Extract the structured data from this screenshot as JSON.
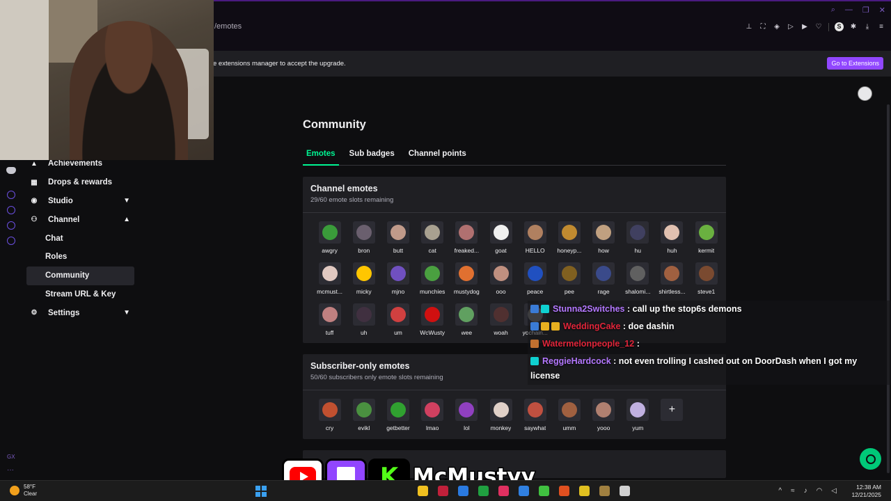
{
  "browser": {
    "url": "/emotes",
    "notice": "e extensions manager to accept the upgrade.",
    "notice_button": "Go to Extensions"
  },
  "sidebar": {
    "items": [
      {
        "label": "Achievements",
        "icon": "trophy-icon"
      },
      {
        "label": "Drops & rewards",
        "icon": "gift-icon"
      },
      {
        "label": "Studio",
        "icon": "studio-icon",
        "chevron": "down"
      },
      {
        "label": "Channel",
        "icon": "people-icon",
        "chevron": "up"
      },
      {
        "label": "Chat"
      },
      {
        "label": "Roles"
      },
      {
        "label": "Community",
        "active": true
      },
      {
        "label": "Stream URL & Key"
      },
      {
        "label": "Settings",
        "icon": "gear-icon",
        "chevron": "down"
      }
    ],
    "gx_label": "GX",
    "more_label": "···"
  },
  "page": {
    "title": "Community",
    "tabs": [
      "Emotes",
      "Sub badges",
      "Channel points"
    ],
    "active_tab": 0
  },
  "channel_emotes": {
    "title": "Channel emotes",
    "subtitle": "29/60 emote slots remaining",
    "emotes": [
      {
        "name": "awgry",
        "color": "#3a9b3a"
      },
      {
        "name": "bron",
        "color": "#6a5f6e"
      },
      {
        "name": "butt",
        "color": "#c09a8a"
      },
      {
        "name": "cat",
        "color": "#a8a090"
      },
      {
        "name": "freaked...",
        "color": "#b07070"
      },
      {
        "name": "goat",
        "color": "#f0f0f0"
      },
      {
        "name": "HELLO",
        "color": "#b08060"
      },
      {
        "name": "honeyp...",
        "color": "#c08a30"
      },
      {
        "name": "how",
        "color": "#c0a080"
      },
      {
        "name": "hu",
        "color": "#404060"
      },
      {
        "name": "huh",
        "color": "#e0c0b0"
      },
      {
        "name": "kermit",
        "color": "#6ab040"
      },
      {
        "name": "mcmust...",
        "color": "#e0c8c0"
      },
      {
        "name": "micky",
        "color": "#ffc600"
      },
      {
        "name": "mjno",
        "color": "#7050c0"
      },
      {
        "name": "munchies",
        "color": "#4aa040"
      },
      {
        "name": "mustydog",
        "color": "#e07030"
      },
      {
        "name": "ooo",
        "color": "#c09080"
      },
      {
        "name": "peace",
        "color": "#2050c0"
      },
      {
        "name": "pee",
        "color": "#806020"
      },
      {
        "name": "rage",
        "color": "#3a4a8a"
      },
      {
        "name": "shalomi...",
        "color": "#606060"
      },
      {
        "name": "shirtless...",
        "color": "#a06040"
      },
      {
        "name": "steve1",
        "color": "#7a4a30"
      },
      {
        "name": "tuff",
        "color": "#c08080"
      },
      {
        "name": "uh",
        "color": "#403040"
      },
      {
        "name": "um",
        "color": "#d04040"
      },
      {
        "name": "WcWusty",
        "color": "#d01010"
      },
      {
        "name": "wee",
        "color": "#60a060"
      },
      {
        "name": "woah",
        "color": "#503030"
      },
      {
        "name": "yochain...",
        "color": "#707070"
      }
    ]
  },
  "subscriber_emotes": {
    "title": "Subscriber-only emotes",
    "subtitle": "50/60 subscribers only emote slots remaining",
    "emotes": [
      {
        "name": "cry",
        "color": "#c05030"
      },
      {
        "name": "evikl",
        "color": "#4a9040"
      },
      {
        "name": "getbetter",
        "color": "#30a030"
      },
      {
        "name": "lmao",
        "color": "#d04060"
      },
      {
        "name": "lol",
        "color": "#9040c0"
      },
      {
        "name": "monkey",
        "color": "#e0d0c8"
      },
      {
        "name": "saywhat",
        "color": "#c05040"
      },
      {
        "name": "umm",
        "color": "#a06040"
      },
      {
        "name": "yooo",
        "color": "#b08070"
      },
      {
        "name": "yum",
        "color": "#c0b0e0"
      }
    ],
    "add_label": "+"
  },
  "chat": [
    {
      "user": "Stunna2Switches",
      "color": "#b478ff",
      "message": ": call up the stop6s demons",
      "badges": [
        "#3a7bd5",
        "#0fd0d0"
      ]
    },
    {
      "user": "WeddingCake",
      "color": "#e0253a",
      "message": ": doe dashin",
      "badges": [
        "#3a7bd5",
        "#e8b020",
        "#e8b020"
      ]
    },
    {
      "user": "Watermelonpeople_12",
      "color": "#e0253a",
      "message": ":",
      "badges": [
        "#c07030"
      ]
    },
    {
      "user": "ReggieHardcock",
      "color": "#b478ff",
      "message": ": not even trolling I cashed out on DoorDash when I got my license",
      "badges": [
        "#0fd0d0"
      ]
    }
  ],
  "stream_brand": {
    "name": "McMustyy",
    "kick_letter": "K"
  },
  "taskbar": {
    "temperature": "58°F",
    "condition": "Clear",
    "time": "12:38 AM",
    "date": "12/21/2025"
  }
}
